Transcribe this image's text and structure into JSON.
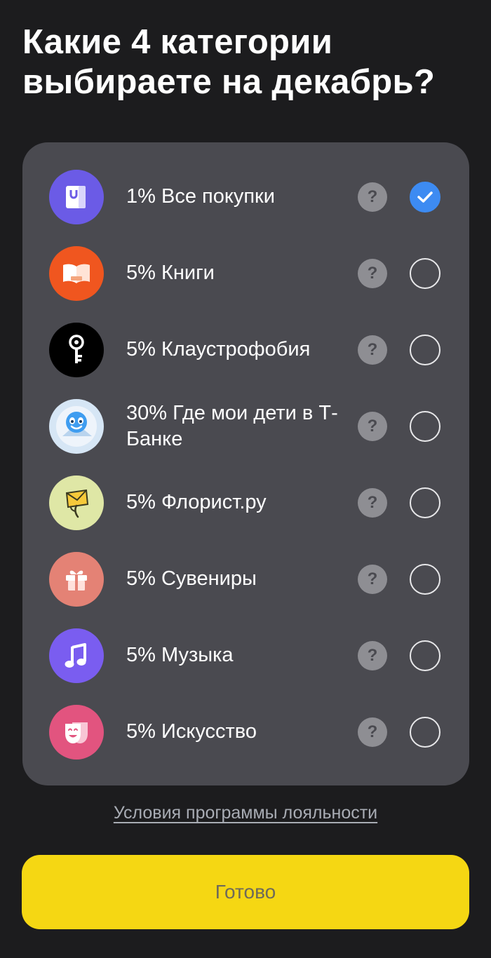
{
  "title": "Какие 4 категории выбираете на декабрь?",
  "categories": [
    {
      "label": "1% Все покупки",
      "icon": "shopping-bag-icon",
      "color": "#6b5be6",
      "selected": true
    },
    {
      "label": "5% Книги",
      "icon": "open-book-icon",
      "color": "#f0561f",
      "selected": false
    },
    {
      "label": "5% Клаустрофобия",
      "icon": "key-icon",
      "color": "#000000",
      "selected": false
    },
    {
      "label": "30% Где мои дети в Т-Банке",
      "icon": "child-face-icon",
      "color": "#d6e6f5",
      "selected": false
    },
    {
      "label": "5% Флорист.ру",
      "icon": "flower-envelope-icon",
      "color": "#dfe7a6",
      "selected": false
    },
    {
      "label": "5% Сувениры",
      "icon": "gift-icon",
      "color": "#e48275",
      "selected": false
    },
    {
      "label": "5% Музыка",
      "icon": "music-note-icon",
      "color": "#7a5df0",
      "selected": false
    },
    {
      "label": "5% Искусство",
      "icon": "theater-mask-icon",
      "color": "#e2547f",
      "selected": false
    }
  ],
  "help_glyph": "?",
  "terms_link": "Условия программы лояльности",
  "done_button": "Готово",
  "colors": {
    "background": "#1c1c1e",
    "card": "#4a4a50",
    "accent_yellow": "#f5d713",
    "check_blue": "#3d8bf2"
  }
}
